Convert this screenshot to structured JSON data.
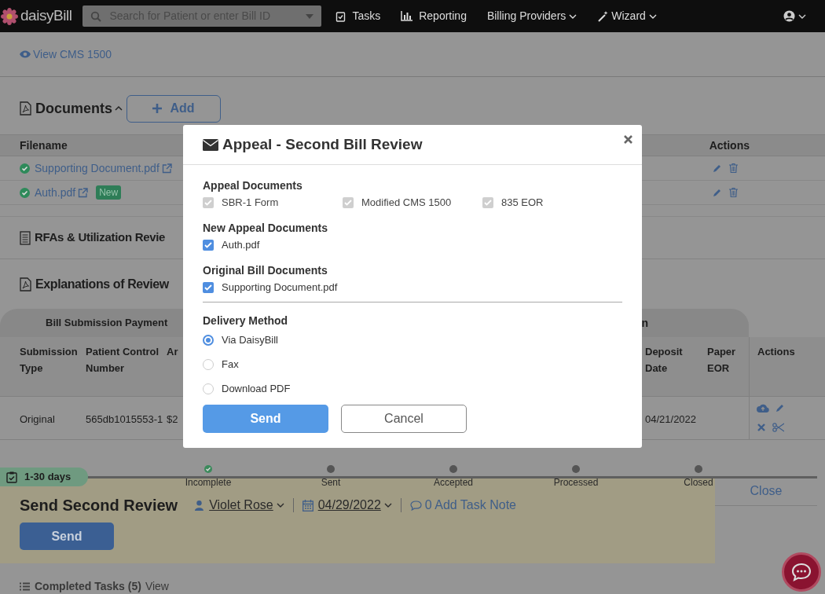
{
  "nav": {
    "logo": "daisyBill",
    "search_placeholder": "Search for Patient or enter Bill ID",
    "items": [
      {
        "label": "Tasks",
        "kind": "tasks"
      },
      {
        "label": "Reporting",
        "kind": "reporting"
      },
      {
        "label": "Billing Providers",
        "kind": "menu"
      },
      {
        "label": "Wizard",
        "kind": "wizard"
      }
    ]
  },
  "view_link": "View CMS 1500",
  "documents": {
    "title": "Documents",
    "add_button": "Add",
    "columns": [
      "Filename",
      "Actions"
    ],
    "rows": [
      {
        "filename": "Supporting Document.pdf"
      },
      {
        "filename": "Auth.pdf",
        "badge": "New"
      }
    ]
  },
  "rfa_title": "RFAs & Utilization Revie",
  "eor": {
    "title": "Explanations of Review",
    "tab": "Bill Submission Payment",
    "tab_2": "n",
    "columns": {
      "submission_type": "Submission Type",
      "patient_control_number": "Patient Control Number",
      "column_3": "Ar",
      "deposit_date": "Deposit Date",
      "paper_eor": "Paper EOR",
      "actions": "Actions"
    },
    "row": {
      "submission_type": "Original",
      "patient_control_number": "565db1015553-1",
      "column_3": "$2",
      "deposit_date": "04/21/2022"
    }
  },
  "task": {
    "days": "1-30 days",
    "steps": [
      {
        "label": "Incomplete",
        "done": true
      },
      {
        "label": "Sent",
        "done": false
      },
      {
        "label": "Accepted",
        "done": false
      },
      {
        "label": "Processed",
        "done": false
      },
      {
        "label": "Closed",
        "done": false
      }
    ],
    "close": "Close",
    "title": "Send Second Review",
    "assignee": "Violet Rose",
    "date": "04/29/2022",
    "note": "0 Add Task Note",
    "send": "Send"
  },
  "completed": {
    "label": "Completed Tasks (5)",
    "link": "View"
  },
  "modal": {
    "title": "Appeal - Second Bill Review",
    "groups": [
      {
        "heading": "Appeal Documents",
        "items": [
          {
            "label": "SBR-1 Form",
            "checked": true,
            "disabled": true
          },
          {
            "label": "Modified CMS 1500",
            "checked": true,
            "disabled": true
          },
          {
            "label": "835 EOR",
            "checked": true,
            "disabled": true
          }
        ]
      },
      {
        "heading": "New Appeal Documents",
        "items": [
          {
            "label": "Auth.pdf",
            "checked": true,
            "disabled": false
          }
        ]
      },
      {
        "heading": "Original Bill Documents",
        "items": [
          {
            "label": "Supporting Document.pdf",
            "checked": true,
            "disabled": false
          }
        ]
      }
    ],
    "delivery": {
      "heading": "Delivery Method",
      "options": [
        {
          "label": "Via DaisyBill",
          "selected": true
        },
        {
          "label": "Fax",
          "selected": false
        },
        {
          "label": "Download PDF",
          "selected": false
        }
      ]
    },
    "buttons": [
      {
        "label": "Send",
        "kind": "primary"
      },
      {
        "label": "Cancel",
        "kind": "secondary"
      }
    ]
  }
}
